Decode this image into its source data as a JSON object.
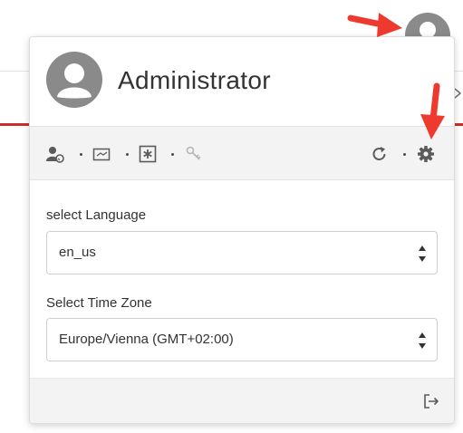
{
  "user": {
    "name": "Administrator"
  },
  "toolbar": {
    "icons": [
      "user-status-icon",
      "mail-icon",
      "star-icon",
      "key-icon",
      "refresh-icon",
      "gear-icon"
    ]
  },
  "language": {
    "label": "select Language",
    "value": "en_us"
  },
  "timezone": {
    "label": "Select Time Zone",
    "value": "Europe/Vienna (GMT+02:00)"
  },
  "footer": {
    "icon": "logout-icon"
  },
  "colors": {
    "accent_red": "#c9302c",
    "annotation_red": "#ee3a2e",
    "icon_gray": "#5a5a5a",
    "avatar_gray": "#8a8a8a"
  }
}
